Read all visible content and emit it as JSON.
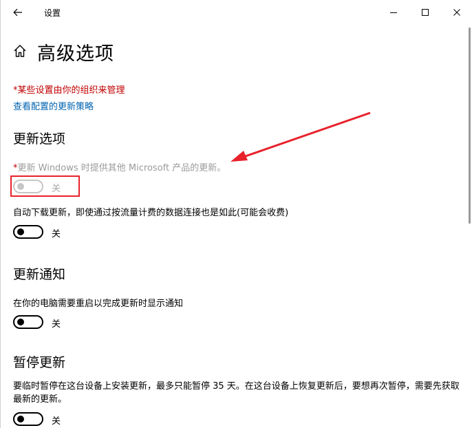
{
  "window": {
    "title": "设置"
  },
  "header": {
    "title": "高级选项"
  },
  "policy": {
    "notice": "*某些设置由你的组织来管理",
    "link": "查看配置的更新策略"
  },
  "sections": {
    "update_options": {
      "heading": "更新选项",
      "item1": {
        "required_mark": "*",
        "desc": "更新 Windows 时提供其他 Microsoft 产品的更新。",
        "state": "关"
      },
      "item2": {
        "desc": "自动下载更新，即使通过按流量计费的数据连接也是如此(可能会收费)",
        "state": "关"
      }
    },
    "update_notifications": {
      "heading": "更新通知",
      "item1": {
        "desc": "在你的电脑需要重启以完成更新时显示通知",
        "state": "关"
      }
    },
    "pause_updates": {
      "heading": "暂停更新",
      "item1": {
        "desc": "要临时暂停在这台设备上安装更新，最多只能暂停 35 天。在这台设备上恢复更新后，要想再次暂停，需要先获取最新的更新。",
        "state": "关"
      }
    }
  },
  "icons": {
    "back": "back-arrow-icon",
    "home": "home-icon",
    "minimize": "minimize-icon",
    "maximize": "maximize-icon",
    "close": "close-icon"
  },
  "colors": {
    "policy_red": "#c00000",
    "link_blue": "#0063b1",
    "highlight_red": "#e8212b",
    "disabled_gray": "#c6c6c6"
  }
}
